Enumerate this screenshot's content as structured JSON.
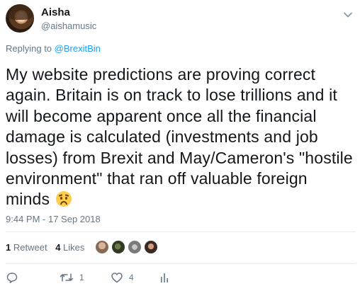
{
  "tweet": {
    "author": {
      "name": "Aisha",
      "handle": "@aishamusic"
    },
    "reply_prefix": "Replying to ",
    "reply_to": "@BrexitBin",
    "text": "My website predictions are proving correct again. Britain is on track to lose trillions and it will become apparent once all the financial damage is calculated (investments and job losses) from Brexit and May/Cameron's \"hostile environment\" that ran off valuable foreign minds",
    "emoji": "worried-face",
    "timestamp": "9:44 PM - 17 Sep 2018"
  },
  "stats": {
    "retweets_count": "1",
    "retweets_label": "Retweet",
    "likes_count": "4",
    "likes_label": "Likes"
  },
  "actions": {
    "reply_icon": "reply-icon",
    "retweet_icon": "retweet-icon",
    "retweet_count": "1",
    "like_icon": "heart-icon",
    "like_count": "4",
    "analytics_icon": "analytics-icon"
  },
  "colors": {
    "link": "#1da1f2",
    "muted": "#657786",
    "text": "#14171a",
    "divider": "#e6ecf0"
  }
}
